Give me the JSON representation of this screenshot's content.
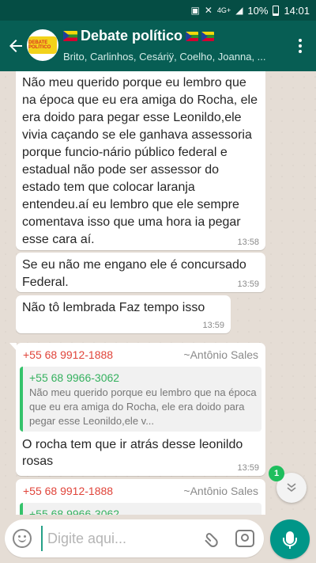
{
  "status_bar": {
    "network": "4G+",
    "battery": "10%",
    "time": "14:01"
  },
  "header": {
    "title": "Debate político",
    "avatar_text": "DEBATE POLÍTICO",
    "members": "Brito, Carlinhos, Cesáriÿ, Coelho, Joanna, ..."
  },
  "messages": [
    {
      "text": "Não meu querido porque eu lembro que na época que eu era amiga do Rocha, ele era doido para pegar esse Leonildo,ele vivia caçando se ele ganhava assessoria porque funcio-nário público federal e estadual não pode ser assessor do estado tem que colocar laranja entendeu.aí eu lembro que ele sempre comentava isso que uma hora ia pegar esse cara aí.",
      "time": "13:58"
    },
    {
      "text": "Se eu não me engano ele é concursado Federal.",
      "time": "13:59"
    },
    {
      "text": "Não tô lembrada Faz tempo isso",
      "time": "13:59"
    },
    {
      "sender_phone": "+55 68 9912-1888",
      "sender_name": "~Antônio Sales",
      "quote_phone": "+55 68 9966-3062",
      "quote_text": "Não meu querido porque eu lembro que na época que eu era amiga do Rocha, ele era doido para pegar esse Leonildo,ele v...",
      "text": "O rocha tem que ir atrás desse leonildo rosas",
      "time": "13:59"
    },
    {
      "sender_phone": "+55 68 9912-1888",
      "sender_name": "~Antônio Sales",
      "quote_phone": "+55 68 9966-3062"
    }
  ],
  "unread_count": "1",
  "composer": {
    "placeholder": "Digite aqui..."
  },
  "colors": {
    "header": "#075e54",
    "status_bar": "#054d44",
    "accent": "#009688",
    "sender_phone": "#e0443a",
    "quote_bar": "#35c36b"
  },
  "icons": [
    "back-arrow-icon",
    "more-options-icon",
    "flag-icon",
    "emoji-icon",
    "attach-icon",
    "camera-icon",
    "mic-icon",
    "chevron-down-icon"
  ]
}
